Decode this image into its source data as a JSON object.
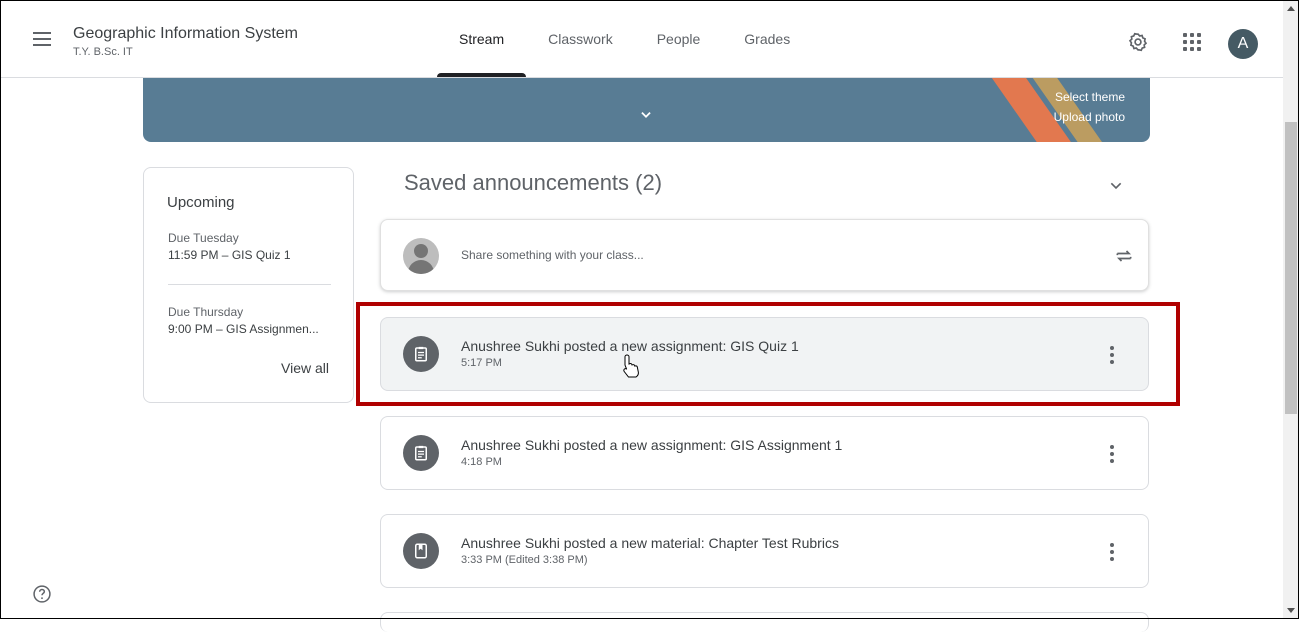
{
  "header": {
    "course_title": "Geographic Information System",
    "course_section": "T.Y. B.Sc. IT",
    "tabs": [
      {
        "label": "Stream",
        "active": true
      },
      {
        "label": "Classwork",
        "active": false
      },
      {
        "label": "People",
        "active": false
      },
      {
        "label": "Grades",
        "active": false
      }
    ],
    "avatar_initial": "A",
    "icons": {
      "menu": "hamburger-menu-icon",
      "settings": "gear-icon",
      "apps": "apps-grid-icon"
    }
  },
  "banner": {
    "select_theme": "Select theme",
    "upload_photo": "Upload photo",
    "background_color": "#587c94"
  },
  "upcoming": {
    "title": "Upcoming",
    "items": [
      {
        "due": "Due Tuesday",
        "task": "11:59 PM – GIS Quiz 1"
      },
      {
        "due": "Due Thursday",
        "task": "9:00 PM – GIS Assignmen..."
      }
    ],
    "view_all": "View all"
  },
  "stream": {
    "saved_announcements": "Saved announcements (2)",
    "share_placeholder": "Share something with your class...",
    "posts": [
      {
        "title": "Anushree Sukhi posted a new assignment: GIS Quiz 1",
        "time": "5:17 PM",
        "icon": "assignment-icon",
        "highlighted": true
      },
      {
        "title": "Anushree Sukhi posted a new assignment: GIS Assignment 1",
        "time": "4:18 PM",
        "icon": "assignment-icon"
      },
      {
        "title": "Anushree Sukhi posted a new material: Chapter Test Rubrics",
        "time": "3:33 PM (Edited 3:38 PM)",
        "icon": "material-icon"
      }
    ]
  },
  "colors": {
    "highlight": "#b00000",
    "icon_circle": "#5f6368"
  }
}
